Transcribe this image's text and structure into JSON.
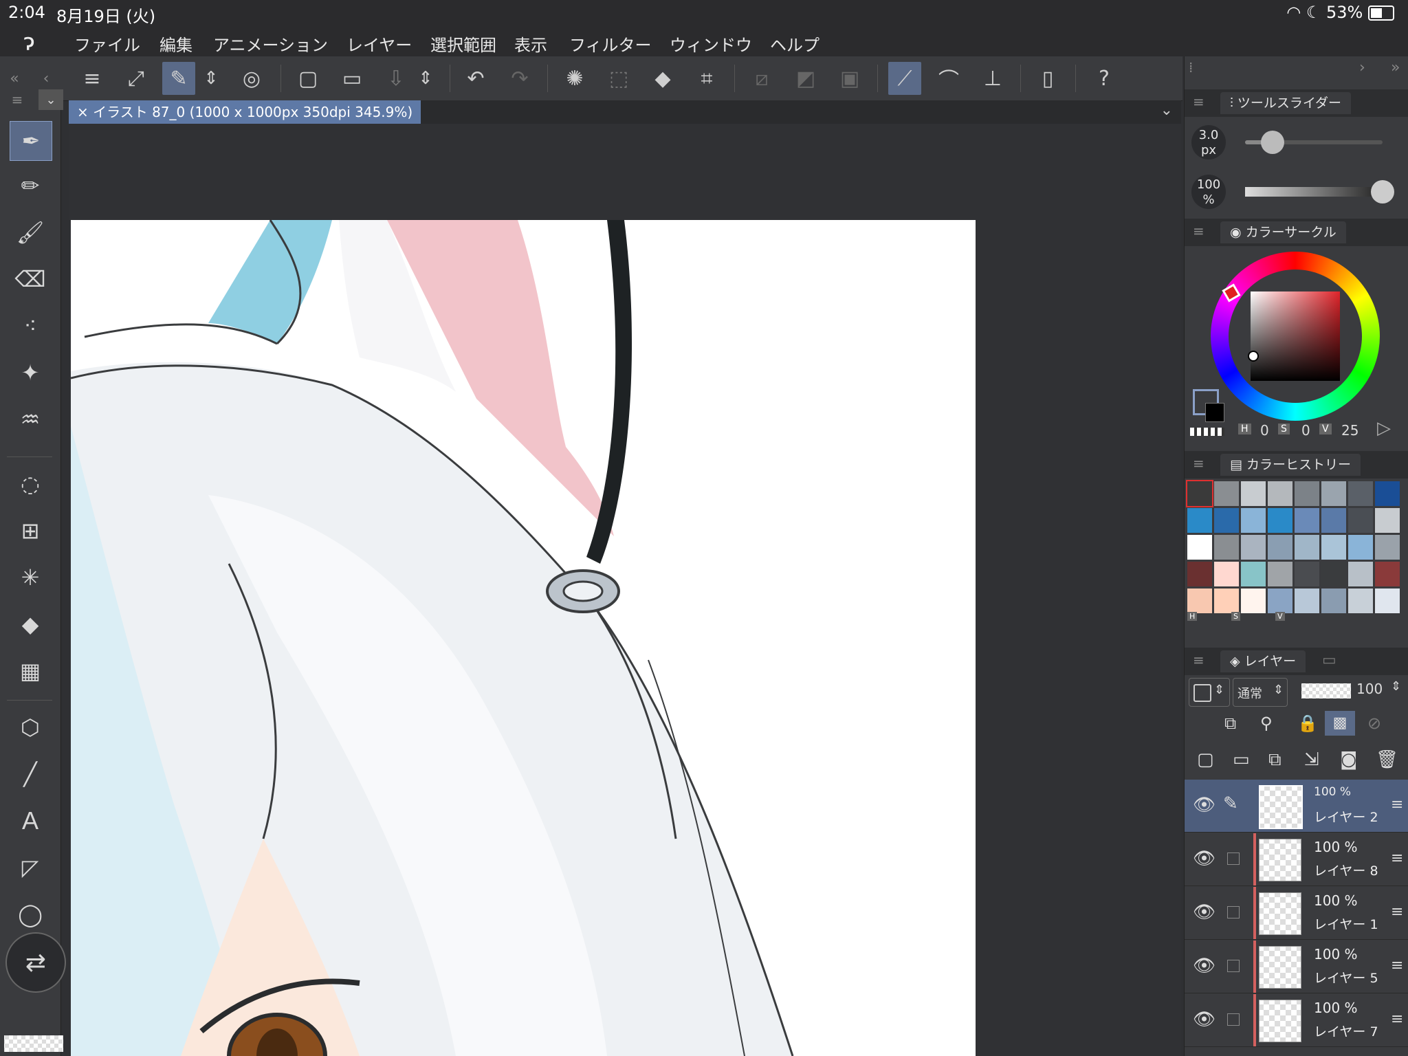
{
  "status": {
    "time": "2:04",
    "date": "8月19日 (火)",
    "battery": "53%"
  },
  "menu": [
    "ファイル",
    "編集",
    "アニメーション",
    "レイヤー",
    "選択範囲",
    "表示",
    "フィルター",
    "ウィンドウ",
    "ヘルプ"
  ],
  "tab": {
    "title": "イラスト 87_0 (1000 x 1000px 350dpi 345.9%)"
  },
  "tool_slider": {
    "title": "ツールスライダー",
    "size_value": "3.0",
    "size_unit": "px",
    "opacity_value": "100",
    "opacity_unit": "%",
    "size_level": 0.2,
    "opacity_level": 1.0
  },
  "color_circle": {
    "title": "カラーサークル",
    "h_label": "H",
    "h": "0",
    "s_label": "S",
    "s": "0",
    "v_label": "V",
    "v": "25"
  },
  "color_history": {
    "title": "カラーヒストリー",
    "footer": [
      "H",
      "S",
      "V"
    ],
    "colors": [
      "#3a3a3a",
      "#8a8e92",
      "#c8ccd0",
      "#b4b8bc",
      "#7c8288",
      "#9aa4ae",
      "#5a6068",
      "#1a4e96",
      "#2a8ac8",
      "#2a6aaa",
      "#8ab4d8",
      "#2a8ac8",
      "#6a8ab8",
      "#5a7aa8",
      "#4a4e54",
      "#c8ccd0",
      "#ffffff",
      "#8a8e92",
      "#aab4c0",
      "#8a9eb2",
      "#a0b6c8",
      "#aac4d8",
      "#8ab4d8",
      "#9aa2aa",
      "#6a3030",
      "#ffd8d0",
      "#88c4c8",
      "#a0a4a8",
      "#4a4c50",
      "#3a3c3e",
      "#b8c0c8",
      "#8a3a3a",
      "#f8c8b0",
      "#ffd0b8",
      "#fff4ee",
      "#8aa4c4",
      "#b8c8d8",
      "#8a9cb0",
      "#c8d0d8",
      "#e0e6ee"
    ]
  },
  "layers": {
    "title": "レイヤー",
    "blend_mode": "通常",
    "opacity": "100",
    "items": [
      {
        "pct": "100 %",
        "name": "レイヤー 2",
        "selected": true
      },
      {
        "pct": "100 %",
        "name": "レイヤー 8",
        "selected": false
      },
      {
        "pct": "100 %",
        "name": "レイヤー 1",
        "selected": false
      },
      {
        "pct": "100 %",
        "name": "レイヤー 5",
        "selected": false
      },
      {
        "pct": "100 %",
        "name": "レイヤー 7",
        "selected": false
      }
    ]
  },
  "colors": {
    "accent": "#5a6a88",
    "tab": "#5e79a6",
    "panel": "#3a3b3e"
  }
}
